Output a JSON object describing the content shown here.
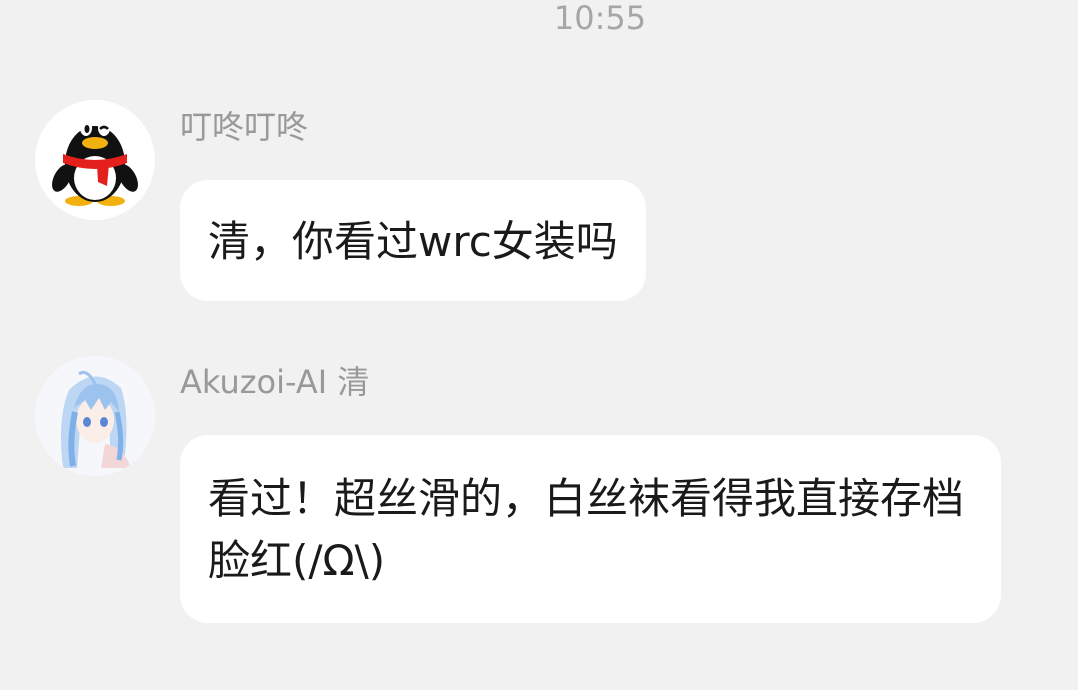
{
  "time_label": "10:55",
  "messages": [
    {
      "sender": "叮咚叮咚",
      "avatar_icon": "qq-penguin-icon",
      "text": "清，你看过wrc女装吗"
    },
    {
      "sender": "Akuzoi-AI 清",
      "avatar_icon": "anime-girl-avatar",
      "text": "看过！超丝滑的，白丝袜看得我直接存档脸红(/Ω\\)"
    }
  ],
  "colors": {
    "background": "#f1f1f1",
    "bubble": "#ffffff",
    "sender_text": "#999999",
    "message_text": "#1a1a1a"
  }
}
